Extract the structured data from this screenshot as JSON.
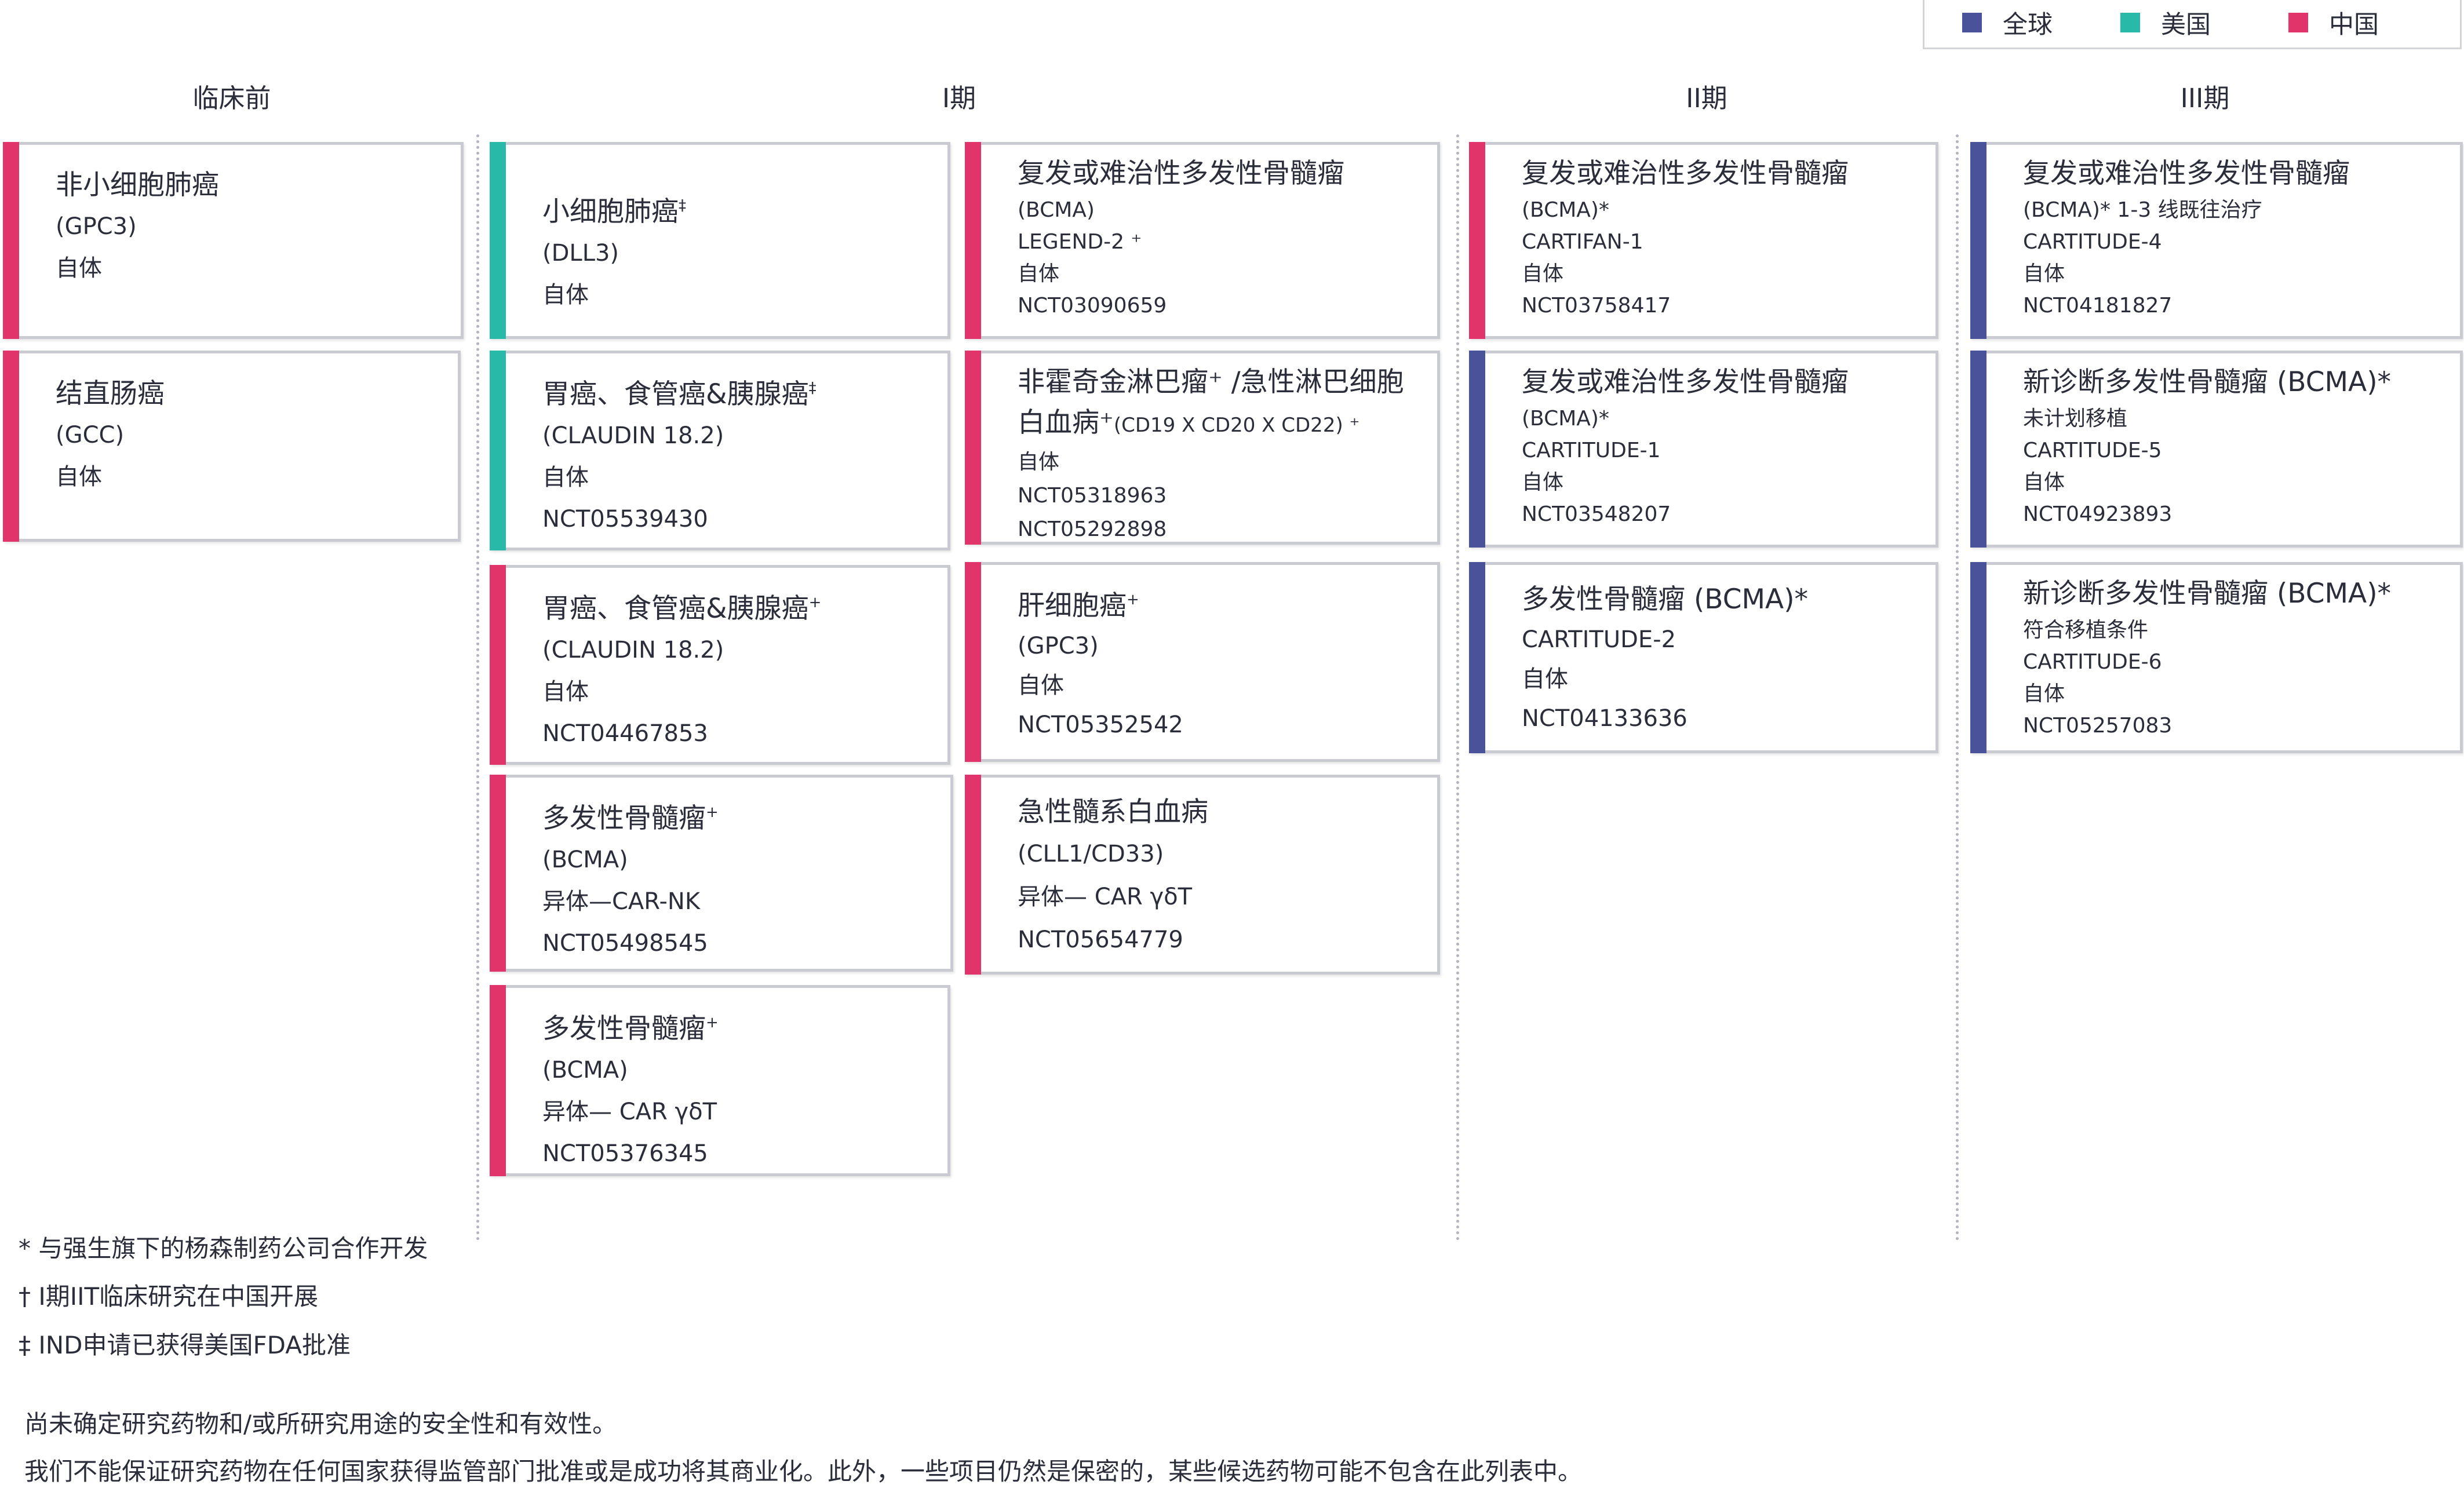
{
  "colors": {
    "global": "#4a5299",
    "us": "#28b9a8",
    "china": "#e1346a",
    "border": "#c9cad2",
    "text": "#2b2e3a"
  },
  "legend": [
    {
      "label": "全球",
      "color_key": "global"
    },
    {
      "label": "美国",
      "color_key": "us"
    },
    {
      "label": "中国",
      "color_key": "china"
    }
  ],
  "phases": {
    "preclinical": "临床前",
    "phase1": "I期",
    "phase2": "II期",
    "phase3": "III期"
  },
  "cards": [
    {
      "id": "pc-1",
      "region": "china",
      "title": "非小细胞肺癌",
      "lines": [
        "(GPC3)",
        "自体"
      ]
    },
    {
      "id": "pc-2",
      "region": "china",
      "title": "结直肠癌",
      "lines": [
        "(GCC)",
        "自体"
      ]
    },
    {
      "id": "p1a-1",
      "region": "us",
      "title": "小细胞肺癌",
      "sup": "‡",
      "lines": [
        "(DLL3)",
        "自体"
      ]
    },
    {
      "id": "p1a-2",
      "region": "us",
      "title": "胃癌、食管癌&胰腺癌",
      "sup": "‡",
      "lines": [
        "(CLAUDIN 18.2)",
        "自体",
        "NCT05539430"
      ]
    },
    {
      "id": "p1a-3",
      "region": "china",
      "title": "胃癌、食管癌&胰腺癌",
      "sup": "+",
      "lines": [
        "(CLAUDIN 18.2)",
        "自体",
        "NCT04467853"
      ]
    },
    {
      "id": "p1a-4",
      "region": "china",
      "title": "多发性骨髓瘤",
      "sup": "+",
      "lines": [
        "(BCMA)",
        "异体—CAR-NK",
        "NCT05498545"
      ]
    },
    {
      "id": "p1a-5",
      "region": "china",
      "title": "多发性骨髓瘤",
      "sup": "+",
      "lines": [
        "(BCMA)",
        "异体— CAR γδT",
        "NCT05376345"
      ]
    },
    {
      "id": "p1b-1",
      "region": "china",
      "title": "复发或难治性多发性骨髓瘤",
      "lines": [
        "(BCMA)",
        "LEGEND-2 ⁺",
        "自体",
        "NCT03090659"
      ]
    },
    {
      "id": "p1b-2",
      "region": "china",
      "title": "非霍奇金淋巴瘤⁺ /急性淋巴细胞",
      "title2": "白血病⁺",
      "title2_small": "(CD19 X CD20 X CD22) ⁺",
      "lines": [
        "自体",
        "NCT05318963",
        "NCT05292898"
      ]
    },
    {
      "id": "p1b-3",
      "region": "china",
      "title": "肝细胞癌",
      "sup": "+",
      "lines": [
        "(GPC3)",
        "自体",
        "NCT05352542"
      ]
    },
    {
      "id": "p1b-4",
      "region": "china",
      "title": "急性髓系白血病",
      "lines": [
        "(CLL1/CD33)",
        "异体— CAR γδT",
        "NCT05654779"
      ]
    },
    {
      "id": "p2-1",
      "region": "china",
      "title": "复发或难治性多发性骨髓瘤",
      "lines": [
        "(BCMA)*",
        "CARTIFAN-1",
        "自体",
        "NCT03758417"
      ]
    },
    {
      "id": "p2-2",
      "region": "global",
      "title": "复发或难治性多发性骨髓瘤",
      "lines": [
        "(BCMA)*",
        "CARTITUDE-1",
        "自体",
        "NCT03548207"
      ]
    },
    {
      "id": "p2-3",
      "region": "global",
      "title": "多发性骨髓瘤 (BCMA)*",
      "lines": [
        "CARTITUDE-2",
        "自体",
        "NCT04133636"
      ]
    },
    {
      "id": "p3-1",
      "region": "global",
      "title": "复发或难治性多发性骨髓瘤",
      "lines": [
        "(BCMA)*   1-3 线既往治疗",
        "CARTITUDE-4",
        "自体",
        "NCT04181827"
      ]
    },
    {
      "id": "p3-2",
      "region": "global",
      "title": "新诊断多发性骨髓瘤 (BCMA)*",
      "lines": [
        "未计划移植",
        "CARTITUDE-5",
        "自体",
        "NCT04923893"
      ]
    },
    {
      "id": "p3-3",
      "region": "global",
      "title": "新诊断多发性骨髓瘤 (BCMA)*",
      "lines": [
        "符合移植条件",
        "CARTITUDE-6",
        "自体",
        "NCT05257083"
      ]
    }
  ],
  "footnotes": [
    "* 与强生旗下的杨森制药公司合作开发",
    "† I期IIT临床研究在中国开展",
    "‡ IND申请已获得美国FDA批准"
  ],
  "disclaimer": [
    "尚未确定研究药物和/或所研究用途的安全性和有效性。",
    "我们不能保证研究药物在任何国家获得监管部门批准或是成功将其商业化。此外，一些项目仍然是保密的，某些候选药物可能不包含在此列表中。"
  ]
}
